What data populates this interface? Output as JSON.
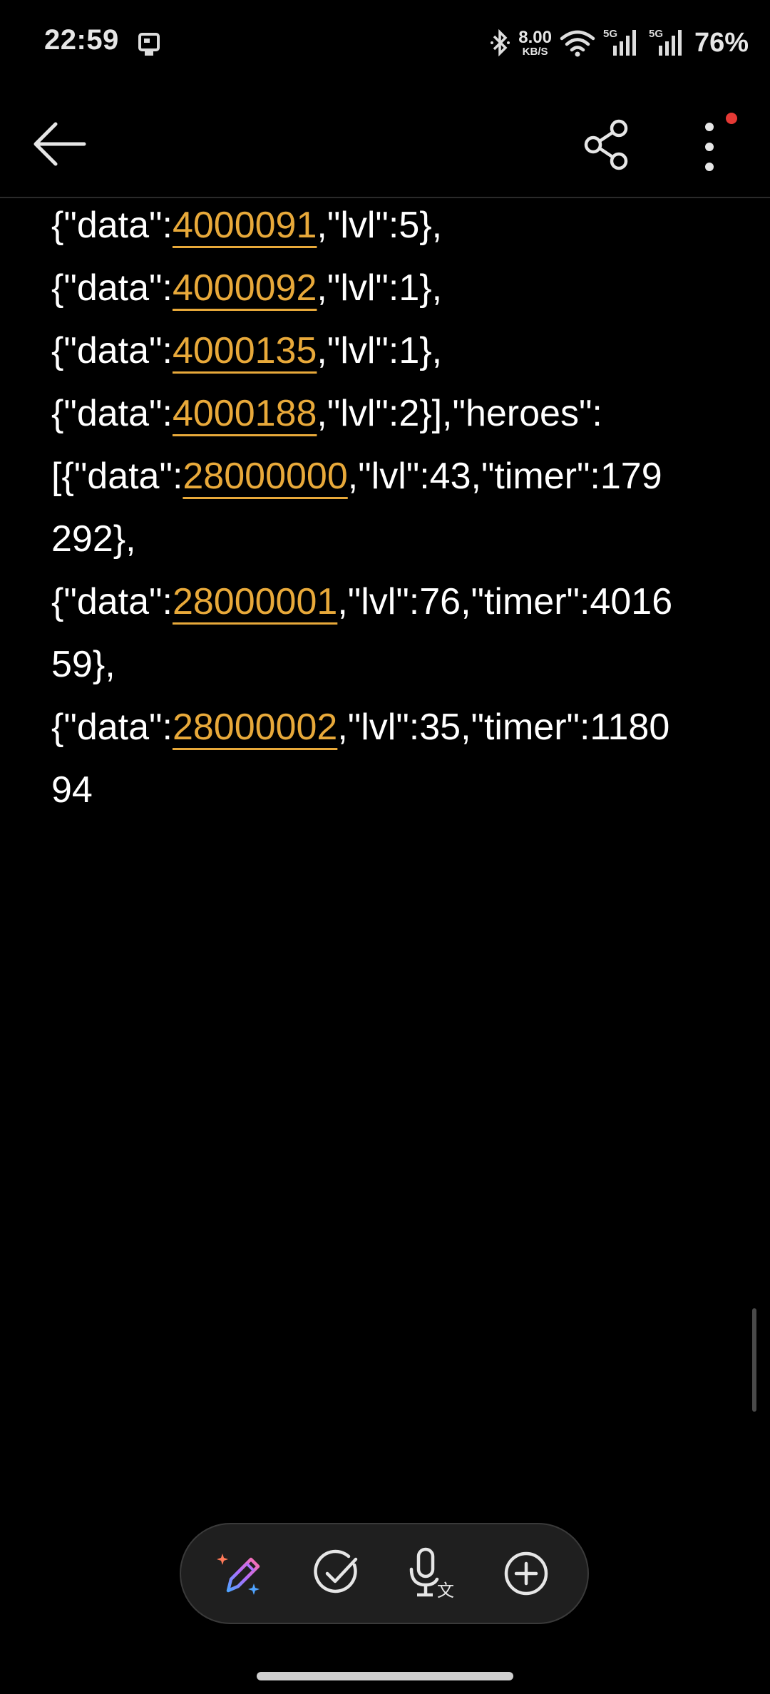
{
  "status_bar": {
    "time": "22:59",
    "speed_value": "8.00",
    "speed_unit": "KB/S",
    "battery": "76%",
    "icons": [
      "nfc-icon",
      "bluetooth-icon",
      "wifi-icon",
      "signal-5g-icon",
      "signal-5g-icon"
    ]
  },
  "toolbar": {
    "back_icon": "back-arrow-icon",
    "share_icon": "share-icon",
    "more_icon": "more-vertical-icon",
    "notification_dot_color": "#e53935"
  },
  "note": {
    "link_color": "#e8a93a",
    "lines": [
      [
        {
          "t": "{\"data\":"
        },
        {
          "t": "4000091",
          "link": true
        },
        {
          "t": ",\"lvl\":5},"
        }
      ],
      [
        {
          "t": "{\"data\":"
        },
        {
          "t": "4000092",
          "link": true
        },
        {
          "t": ",\"lvl\":1},"
        }
      ],
      [
        {
          "t": "{\"data\":"
        },
        {
          "t": "4000135",
          "link": true
        },
        {
          "t": ",\"lvl\":1},"
        }
      ],
      [
        {
          "t": "{\"data\":"
        },
        {
          "t": "4000188",
          "link": true
        },
        {
          "t": ",\"lvl\":2}],\"heroes\":"
        }
      ],
      [
        {
          "t": "[{\"data\":"
        },
        {
          "t": "28000000",
          "link": true
        },
        {
          "t": ",\"lvl\":43,\"timer\":179"
        }
      ],
      [
        {
          "t": "292},"
        }
      ],
      [
        {
          "t": "{\"data\":"
        },
        {
          "t": "28000001",
          "link": true
        },
        {
          "t": ",\"lvl\":76,\"timer\":4016"
        }
      ],
      [
        {
          "t": "59},"
        }
      ],
      [
        {
          "t": "{\"data\":"
        },
        {
          "t": "28000002",
          "link": true
        },
        {
          "t": ",\"lvl\":35,\"timer\":1180"
        }
      ],
      [
        {
          "t": "94"
        }
      ]
    ]
  },
  "bottom_toolbar": {
    "items": [
      "ai-pen-icon",
      "checklist-icon",
      "voice-to-text-icon",
      "add-icon"
    ]
  }
}
